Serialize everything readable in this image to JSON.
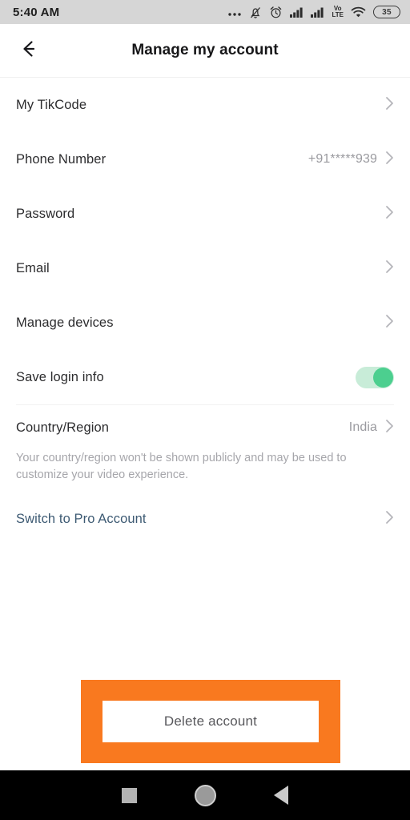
{
  "statusbar": {
    "time": "5:40 AM",
    "battery_level": "35",
    "icons": [
      "more-dots-icon",
      "bell-muted-icon",
      "alarm-clock-icon",
      "signal-bars-icon",
      "signal-bars-2-icon",
      "volte-icon",
      "wifi-icon",
      "battery-icon"
    ],
    "volte_top": "Vo",
    "volte_bottom": "LTE",
    "background_color": "#d6d6d6"
  },
  "header": {
    "title": "Manage my account",
    "back_icon": "arrow-left-icon"
  },
  "settings": {
    "rows": [
      {
        "label": "My TikCode",
        "value": ""
      },
      {
        "label": "Phone Number",
        "value": "+91*****939"
      },
      {
        "label": "Password",
        "value": ""
      },
      {
        "label": "Email",
        "value": ""
      },
      {
        "label": "Manage devices",
        "value": ""
      }
    ],
    "save_login": {
      "label": "Save login info",
      "enabled": true,
      "track_color": "#c8ecd8",
      "knob_color": "#4ccf8f"
    },
    "country": {
      "label": "Country/Region",
      "value": "India",
      "note": "Your country/region won't be shown publicly and may be used to customize your video experience."
    },
    "pro_account": {
      "label": "Switch to Pro Account",
      "color": "#3d5a73"
    }
  },
  "delete": {
    "label": "Delete account",
    "highlight_color": "#f9791f"
  },
  "navbar": {
    "recents": "square-icon",
    "home": "circle-icon",
    "back": "triangle-left-icon"
  }
}
